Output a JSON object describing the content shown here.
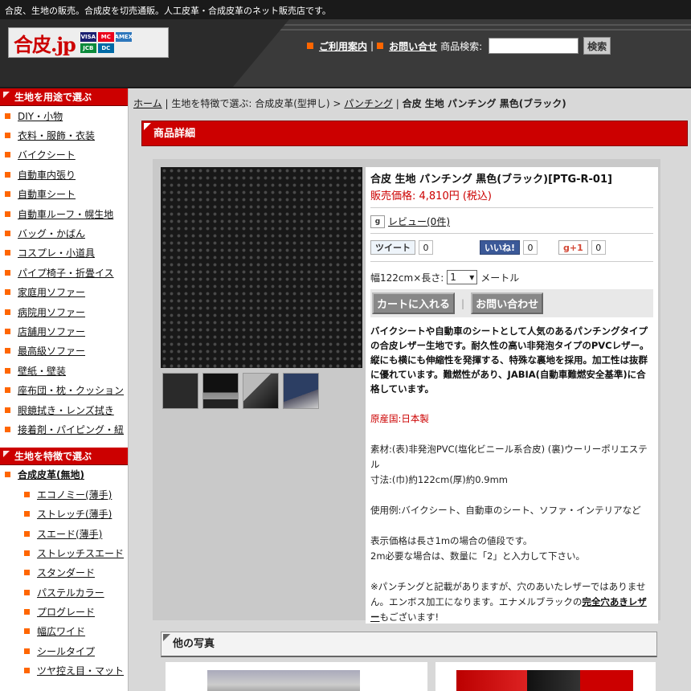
{
  "header": {
    "tagline": "合皮、生地の販売。合成皮を切売通販。人工皮革・合成皮革のネット販売店です。",
    "logo": "合皮.jp",
    "cards": [
      "VISA",
      "MC",
      "AMEX",
      "JCB",
      "DC"
    ],
    "nav_guide": "ご利用案内",
    "nav_contact": "お問い合せ",
    "search_label": "商品検索:",
    "search_button": "検索"
  },
  "sidebar": {
    "use_heading": "生地を用途で選ぶ",
    "use_items": [
      "DIY・小物",
      "衣料・服飾・衣装",
      "バイクシート",
      "自動車内張り",
      "自動車シート",
      "自動車ルーフ・幌生地",
      "バッグ・かばん",
      "コスプレ・小道具",
      "パイプ椅子・折畳イス",
      "家庭用ソファー",
      "病院用ソファー",
      "店舗用ソファー",
      "最高級ソファー",
      "壁紙・壁装",
      "座布団・枕・クッション",
      "眼鏡拭き・レンズ拭き",
      "接着剤・パイピング・紐"
    ],
    "feature_heading": "生地を特徴で選ぶ",
    "feature_top": "合成皮革(無地)",
    "feature_items": [
      "エコノミー(薄手)",
      "ストレッチ(薄手)",
      "スエード(薄手)",
      "ストレッチスエード",
      "スタンダード",
      "パステルカラー",
      "プログレード",
      "幅広ワイド",
      "シールタイプ",
      "ツヤ控え目・マット"
    ]
  },
  "breadcrumb": {
    "home": "ホーム",
    "sep": "|",
    "middle": "生地を特徴で選ぶ: 合成皮革(型押し) >",
    "punching": "パンチング",
    "current": "合皮 生地 パンチング 黒色(ブラック)"
  },
  "detail": {
    "heading": "商品詳細",
    "title": "合皮 生地 パンチング 黒色(ブラック)[PTG-R-01]",
    "price": "販売価格: 4,810円 (税込)",
    "review_icon": "g",
    "review": "レビュー(0件)",
    "tweet": "ツイート",
    "tweet_count": "0",
    "like": "いいね!",
    "like_count": "0",
    "gplus": "g+1",
    "gplus_count": "0",
    "width_label": "幅122cm×長さ:",
    "length_value": "1",
    "unit": "メートル",
    "cart_button": "カートに入れる",
    "inquiry_button": "お問い合わせ",
    "description": "バイクシートや自動車のシートとして人気のあるパンチングタイプの合皮レザー生地です。耐久性の高い非発泡タイプのPVCレザー。縦にも横にも伸縮性を発揮する、特殊な裏地を採用。加工性は抜群に優れています。難燃性があり、JABIA(自動車難燃安全基準)に合格しています。",
    "origin": "原産国:日本製",
    "material": "素材:(表)非発泡PVC(塩化ビニール系合皮) (裏)ウーリーポリエステル",
    "size": "寸法:(巾)約122cm(厚)約0.9mm",
    "usage": "使用例:バイクシート、自動車のシート、ソファ・インテリアなど",
    "price_note": "表示価格は長さ1mの場合の値段です。",
    "qty_note": "2m必要な場合は、数量に「2」と入力して下さい。",
    "note_pre": "※パンチングと記載がありますが、穴のあいたレザーではありません。エンボス加工になります。エナメルブラックの",
    "note_link": "完全穴あきレザー",
    "note_post": "もございます!",
    "other_photos": "他の写真"
  }
}
